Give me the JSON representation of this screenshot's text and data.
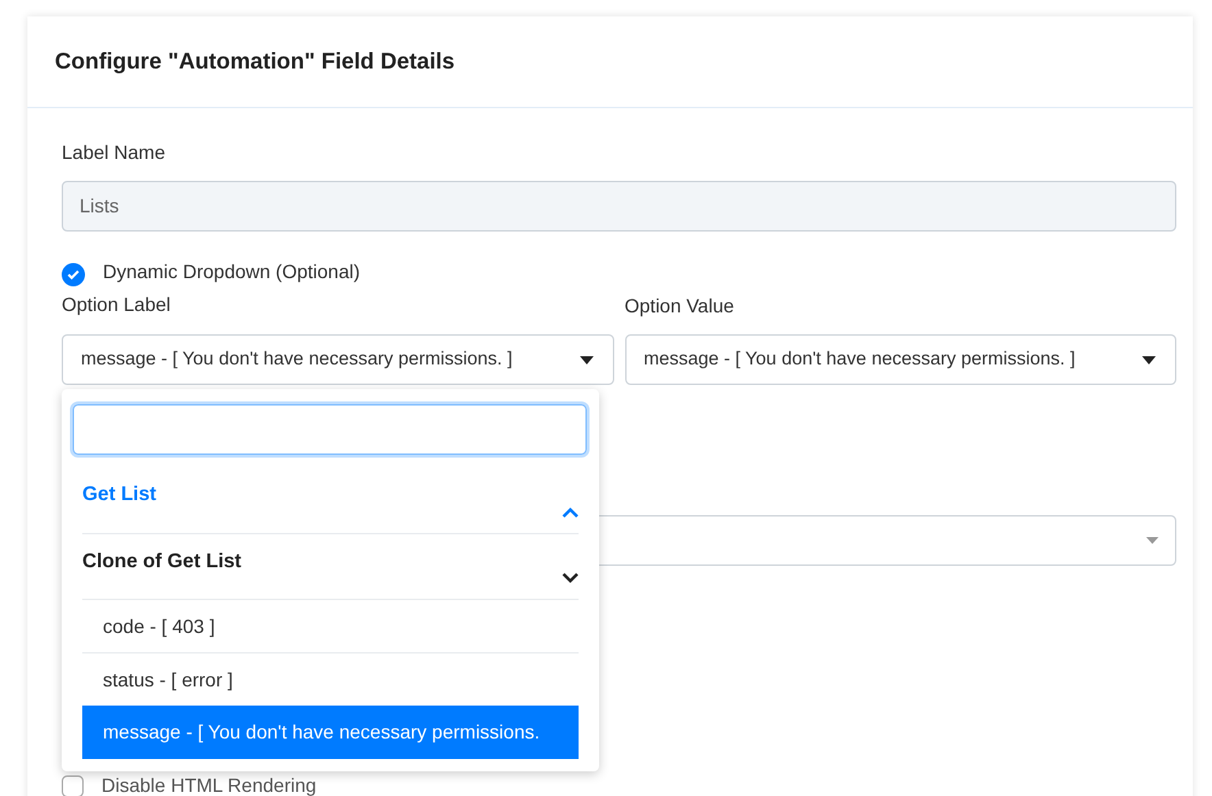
{
  "panel": {
    "title": "Configure \"Automation\" Field Details"
  },
  "label_name": {
    "label": "Label Name",
    "value": "Lists"
  },
  "dynamic_dropdown": {
    "label": "Dynamic Dropdown (Optional)",
    "checked": true
  },
  "option_label": {
    "label": "Option Label",
    "value": "message - [ You don't have necessary permissions. ]"
  },
  "option_value": {
    "label": "Option Value",
    "value": "message - [ You don't have necessary permissions. ]"
  },
  "dropdown_menu": {
    "groups": [
      {
        "label": "Get List",
        "expanded": true
      },
      {
        "label": "Clone of Get List",
        "expanded": false,
        "options": [
          {
            "label": "code - [ 403 ]",
            "selected": false
          },
          {
            "label": "status - [ error ]",
            "selected": false
          },
          {
            "label": "message - [ You don't have necessary permissions.",
            "selected": true
          }
        ]
      }
    ]
  },
  "disable_html_rendering": {
    "label": "Disable HTML Rendering",
    "checked": false
  }
}
